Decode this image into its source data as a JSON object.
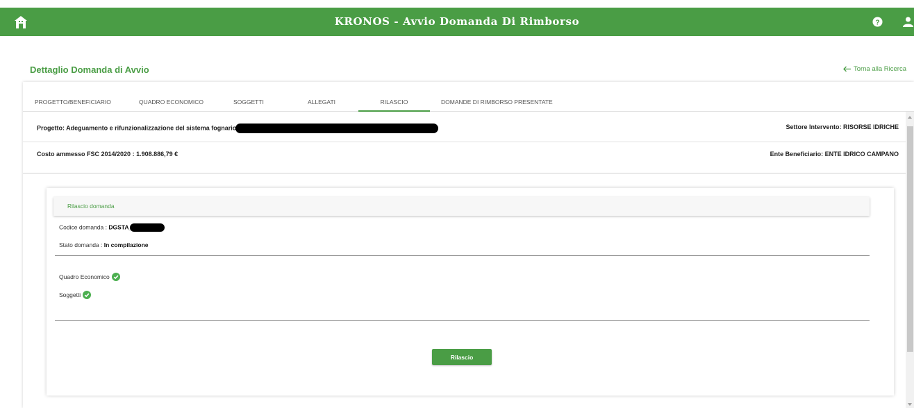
{
  "topbar": {
    "title": "KRONOS - Avvio Domanda Di Rimborso",
    "icons": {
      "home": "home-icon",
      "help": "help-icon",
      "user": "user-icon"
    },
    "color": "#4a9d45"
  },
  "header": {
    "page_title": "Dettaglio Domanda di Avvio",
    "back_label": "Torna alla Ricerca"
  },
  "tabs": [
    {
      "label": "PROGETTO/BENEFICIARIO"
    },
    {
      "label": "QUADRO ECONOMICO"
    },
    {
      "label": "SOGGETTI"
    },
    {
      "label": "ALLEGATI"
    },
    {
      "label": "RILASCIO",
      "active": true
    },
    {
      "label": "DOMANDE DI RIMBORSO PRESENTATE"
    }
  ],
  "info": {
    "progetto": "Progetto:  Adeguamento e rifunzionalizzazione del sistema fognario",
    "settore": "Settore Intervento:  RISORSE IDRICHE",
    "costo": "Costo ammesso FSC 2014/2020 : 1.908.886,79 €",
    "ente": "Ente Beneficiario:  ENTE IDRICO CAMPANO"
  },
  "release": {
    "header": "Rilascio domanda",
    "codice_label": "Codice domanda : ",
    "codice_value": "DGSTA_",
    "stato_label": "Stato domanda : ",
    "stato_value": "In compilazione",
    "checks": [
      {
        "label": "Quadro Economico"
      },
      {
        "label": "Soggetti"
      }
    ],
    "button_label": "Rilascio"
  }
}
